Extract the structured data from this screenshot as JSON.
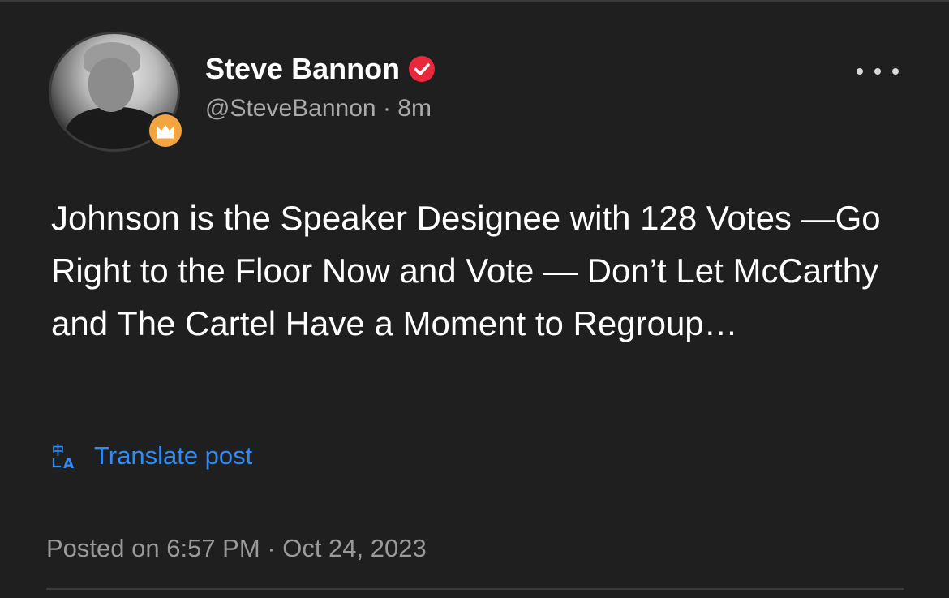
{
  "author": {
    "display_name": "Steve Bannon",
    "handle": "@SteveBannon",
    "time_ago": "8m",
    "separator": "·"
  },
  "post": {
    "text": "Johnson is the Speaker Designee with 128 Votes —Go Right to the Floor Now and Vote — Don’t Let McCarthy and The Cartel Have a Moment to Regroup…"
  },
  "translate": {
    "label": "Translate post"
  },
  "meta": {
    "posted": "Posted on 6:57 PM · Oct 24, 2023"
  },
  "icons": {
    "verified": "verified-check-icon",
    "badge": "crown-badge-icon",
    "more": "more-options-icon",
    "translate": "translate-icon"
  },
  "colors": {
    "background": "#1f1f1f",
    "verified": "#e8293b",
    "link": "#2f8cf5",
    "badge": "#f2a541",
    "muted": "#a9a9a9"
  }
}
